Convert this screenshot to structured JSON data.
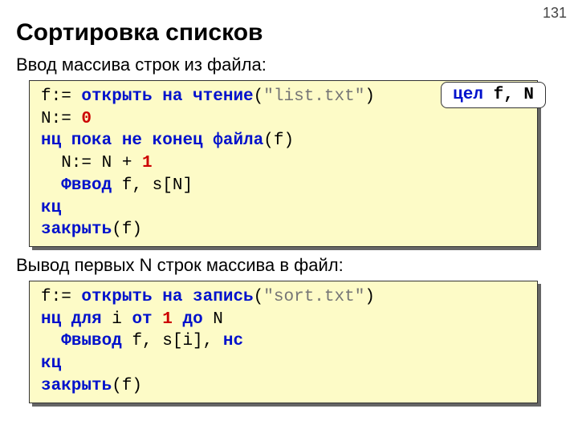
{
  "page_number": "131",
  "title": "Сортировка списков",
  "section1": {
    "heading": "Ввод массива строк из файла:",
    "annotation": {
      "kw": "цел",
      "vars": " f, N"
    },
    "code": {
      "l1a": "f:= ",
      "l1b": "открыть на чтение",
      "l1c": "(",
      "l1d": "\"list.txt\"",
      "l1e": ")",
      "l2a": "N:= ",
      "l2b": "0",
      "l3a": "нц пока не",
      "l3b": " ",
      "l3c": "конец файла",
      "l3d": "(f)",
      "l4a": "  N:= N + ",
      "l4b": "1",
      "l5a": "  ",
      "l5b": "Фввод",
      "l5c": " f, s[N]",
      "l6a": "кц",
      "l7a": "закрыть",
      "l7b": "(f)"
    }
  },
  "section2": {
    "heading": "Вывод первых N строк массива в файл:",
    "code": {
      "l1a": "f:= ",
      "l1b": "открыть на запись",
      "l1c": "(",
      "l1d": "\"sort.txt\"",
      "l1e": ")",
      "l2a": "нц для",
      "l2b": " i ",
      "l2c": "от",
      "l2d": " ",
      "l2e": "1",
      "l2f": " ",
      "l2g": "до",
      "l2h": " N",
      "l3a": "  ",
      "l3b": "Фвывод",
      "l3c": " f, s[i], ",
      "l3d": "нс",
      "l4a": "кц",
      "l5a": "закрыть",
      "l5b": "(f)"
    }
  }
}
